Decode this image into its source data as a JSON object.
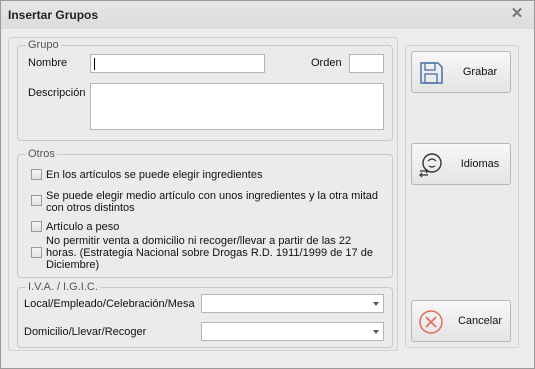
{
  "window": {
    "title": "Insertar Grupos",
    "close_glyph": "✕"
  },
  "grupo": {
    "legend": "Grupo",
    "nombre_label": "Nombre",
    "nombre_value": "",
    "orden_label": "Orden",
    "orden_value": "",
    "descripcion_label": "Descripción",
    "descripcion_value": ""
  },
  "otros": {
    "legend": "Otros",
    "options": [
      {
        "label": "En los artículos se puede elegir ingredientes",
        "checked": false
      },
      {
        "label": "Se puede elegir medio artículo con unos ingredientes y la otra mitad con otros distintos",
        "checked": false
      },
      {
        "label": "Artículo a peso",
        "checked": false
      },
      {
        "label": "No permitir venta a domicilio ni recoger/llevar a partir de las 22 horas. (Estrategia Nacional sobre Drogas R.D. 1911/1999 de 17 de Diciembre)",
        "checked": false
      }
    ]
  },
  "iva": {
    "legend": "I.V.A. / I.G.I.C.",
    "local_label": "Local/Empleado/Celebración/Mesa",
    "local_value": "",
    "domicilio_label": "Domicilio/Llevar/Recoger",
    "domicilio_value": ""
  },
  "buttons": {
    "grabar": {
      "label": "Grabar",
      "icon": "floppy-disk-icon"
    },
    "idiomas": {
      "label": "Idiomas",
      "icon": "language-bubbles-icon"
    },
    "cancelar": {
      "label": "Cancelar",
      "icon": "cancel-circle-icon"
    }
  },
  "colors": {
    "cancel_accent": "#e8675a",
    "icon_blue": "#4a6fa5"
  }
}
